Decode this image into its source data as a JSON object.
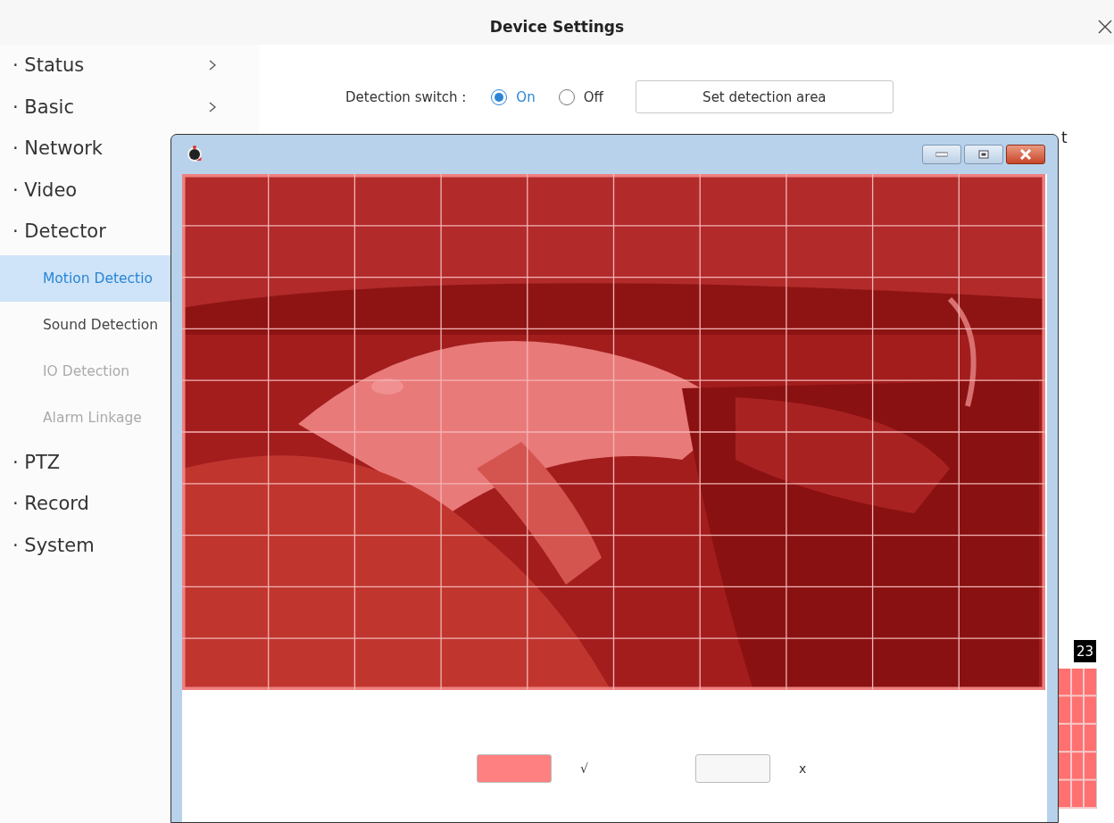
{
  "window": {
    "title": "Device Settings"
  },
  "sidebar": {
    "items": [
      {
        "label": "· Status",
        "chevron": true
      },
      {
        "label": "· Basic",
        "chevron": true
      },
      {
        "label": "· Network",
        "chevron": false
      },
      {
        "label": "· Video",
        "chevron": false
      },
      {
        "label": "· Detector",
        "chevron": false,
        "children": [
          {
            "label": "Motion Detectio",
            "selected": true,
            "disabled": false
          },
          {
            "label": "Sound Detection",
            "selected": false,
            "disabled": false
          },
          {
            "label": "IO Detection",
            "selected": false,
            "disabled": true
          },
          {
            "label": "Alarm Linkage",
            "selected": false,
            "disabled": true
          }
        ]
      },
      {
        "label": "· PTZ",
        "chevron": false
      },
      {
        "label": "· Record",
        "chevron": false
      },
      {
        "label": "· System",
        "chevron": false
      }
    ]
  },
  "detection_switch": {
    "label": "Detection switch :",
    "options": [
      {
        "label": "On",
        "selected": true
      },
      {
        "label": "Off",
        "selected": false
      }
    ],
    "button": "Set detection area"
  },
  "covered_text": "t",
  "schedule": {
    "hour_label": "23"
  },
  "area_dialog": {
    "legend": [
      {
        "color": "#ff8080",
        "symbol": "√"
      },
      {
        "color": "#f7f7f7",
        "symbol": "x"
      }
    ]
  }
}
